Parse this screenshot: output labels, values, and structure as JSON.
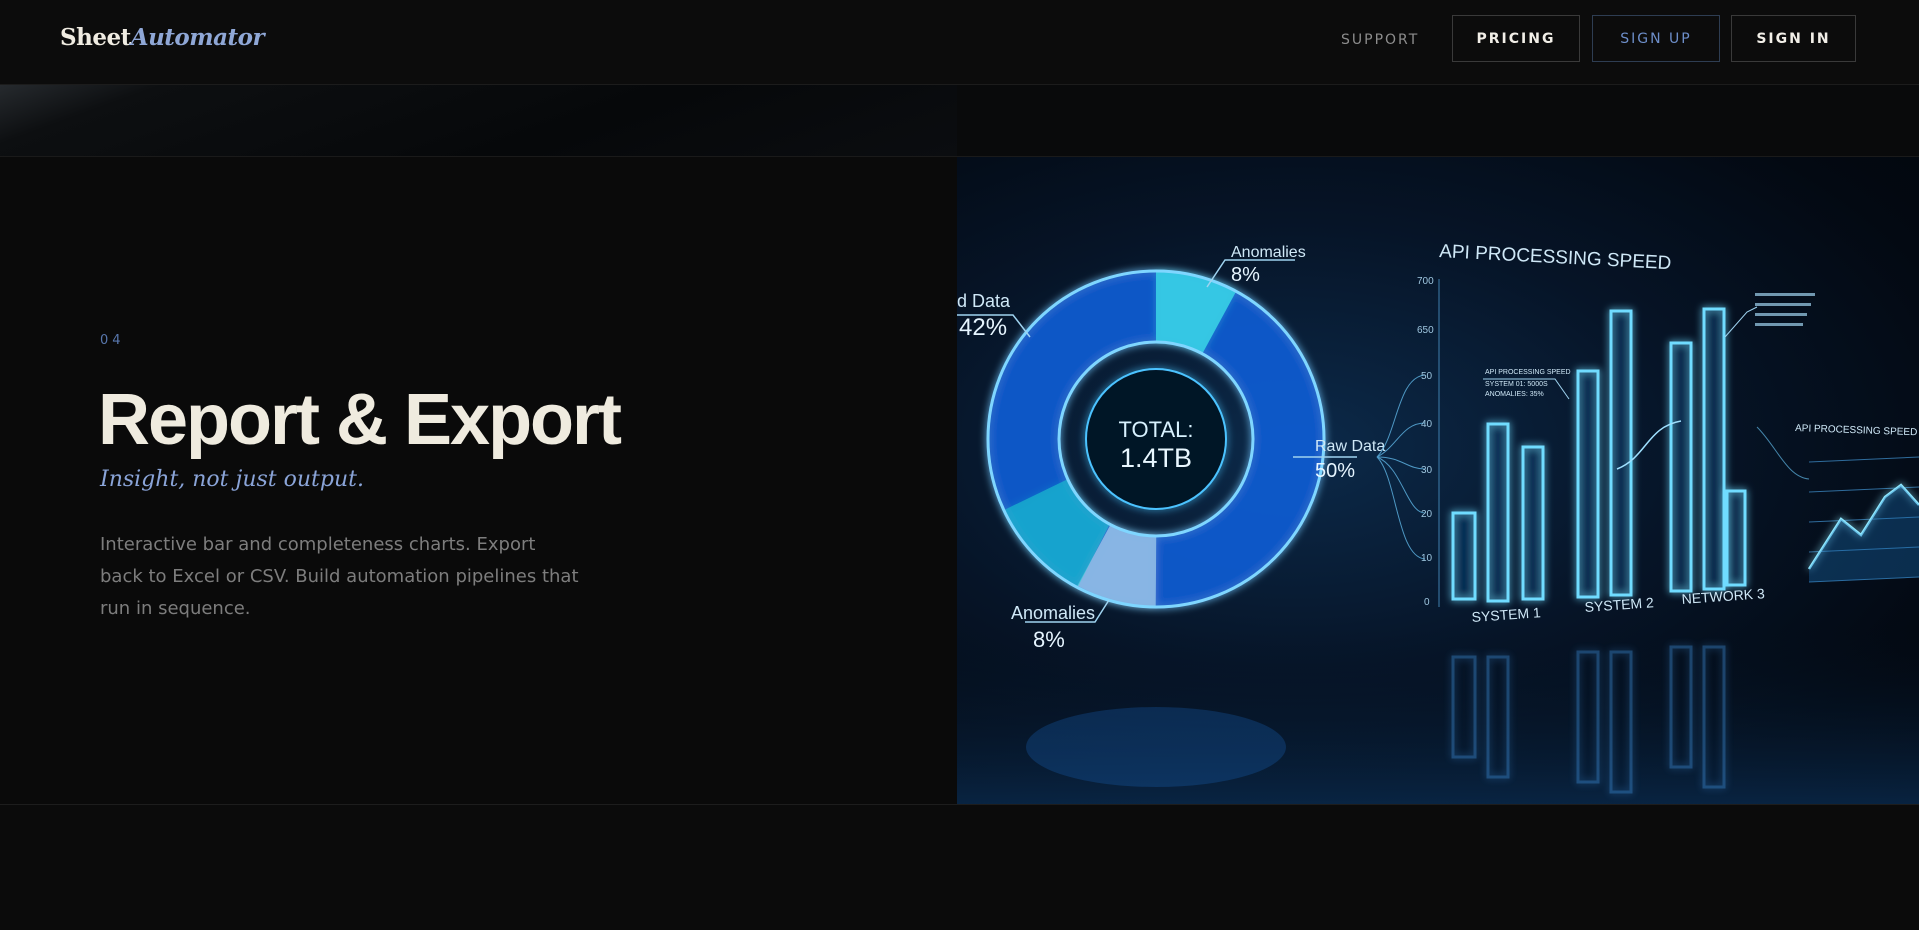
{
  "brand": {
    "name_part1": "Sheet",
    "name_part2": "Automator"
  },
  "nav": {
    "support": "SUPPORT",
    "pricing": "PRICING",
    "signup": "SIGN UP",
    "signin": "SIGN IN"
  },
  "feature": {
    "number": "04",
    "title": "Report & Export",
    "tagline": "Insight, not just output.",
    "description": "Interactive bar and completeness charts. Export back to Excel or CSV. Build automation pipelines that run in sequence."
  },
  "illustration": {
    "donut_total_label": "TOTAL:",
    "donut_total_value": "1.4TB",
    "labels": {
      "top_anomalies": "Anomalies",
      "top_anomalies_pct": "8%",
      "left_data": "d Data",
      "left_data_pct": "42%",
      "raw_data": "Raw Data",
      "raw_data_pct": "50%",
      "bottom_anomalies": "Anomalies",
      "bottom_anomalies_pct": "8%"
    },
    "bar_chart_title": "API PROCESSING SPEED",
    "y_ticks": [
      "700",
      "650",
      "50",
      "40",
      "30",
      "20",
      "10",
      "0"
    ],
    "x_labels": [
      "SYSTEM 1",
      "SYSTEM 2",
      "NETWORK 3"
    ],
    "mini_chart_title": "API PROCESSING SPEED",
    "note_title": "API PROCESSING SPEED",
    "note_line1": "SYSTEM 01: 5000S",
    "note_line2": "ANOMALIES: 35%",
    "accent_color": "#4aa8ff",
    "accent_color_light": "#8fe8ff"
  }
}
